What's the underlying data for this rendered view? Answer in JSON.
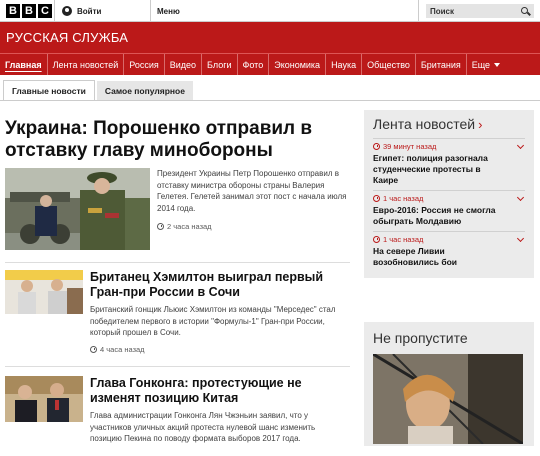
{
  "header": {
    "logo_letters": [
      "B",
      "B",
      "C"
    ],
    "signin_label": "Войти",
    "menu_label": "Меню",
    "search_placeholder": "Поиск"
  },
  "brand": {
    "title": "РУССКАЯ СЛУЖБА"
  },
  "nav": {
    "items": [
      "Главная",
      "Лента новостей",
      "Россия",
      "Видео",
      "Блоги",
      "Фото",
      "Экономика",
      "Наука",
      "Общество",
      "Британия",
      "Еще"
    ],
    "active_index": 0
  },
  "tabs": [
    {
      "label": "Главные новости",
      "active": true
    },
    {
      "label": "Самое популярное",
      "active": false
    }
  ],
  "main": {
    "lead": {
      "title": "Украина: Порошенко отправил в отставку главу минобороны",
      "summary": "Президент Украины Петр Порошенко отправил в отставку министра обороны страны Валерия Гелетея. Гелетей занимал этот пост с начала июля 2014 года.",
      "time": "2 часа назад"
    },
    "stories": [
      {
        "title": "Британец Хэмилтон выиграл первый Гран-при России в Сочи",
        "summary": "Британский гонщик Льюис Хэмилтон из команды \"Мерседес\" стал победителем первого в истории \"Формулы-1\" Гран-при России, который прошел в Сочи.",
        "time": "4 часа назад"
      },
      {
        "title": "Глава Гонконга: протестующие не изменят позицию Китая",
        "summary": "Глава администрации Гонконга Лян Чжэньин заявил, что у участников уличных акций протеста нулевой шанс изменить позицию Пекина по поводу формата выборов 2017 года."
      }
    ]
  },
  "sidebar": {
    "news_feed": {
      "title": "Лента новостей",
      "items": [
        {
          "time": "39 минут назад",
          "title": "Египет: полиция разогнала студенческие протесты в Каире"
        },
        {
          "time": "1 час назад",
          "title": "Евро-2016: Россия не смогла обыграть Молдавию"
        },
        {
          "time": "1 час назад",
          "title": "На севере Ливии возобновились бои"
        }
      ]
    },
    "dont_miss": {
      "title": "Не пропустите"
    }
  },
  "colors": {
    "brand_red": "#bb1919",
    "panel_gray": "#ebebeb"
  }
}
